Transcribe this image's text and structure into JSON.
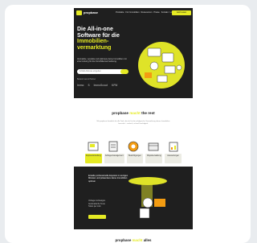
{
  "brand": {
    "logo_mark": "sk",
    "name": "propbase"
  },
  "nav": {
    "links": [
      "Produkte",
      "Für Immobilien",
      "Ressourcen",
      "Preise",
      "Kontakt",
      "Login"
    ],
    "cta": "Jetzt testen"
  },
  "hero": {
    "title_lines": [
      "Die All-in-one",
      "Software für die"
    ],
    "title_highlight_lines": [
      "Immobilien-",
      "vermarktung"
    ],
    "subtitle": "Vermarkte, verwalte und optimiere deine Immobilien mit einer Lösung für die Immobilienvermarktung.",
    "input_placeholder": "E-Mail-Adresse eingeben",
    "references_label": "Bekannt aus & Partner",
    "reference_logos": [
      "Immo",
      "S",
      "ImmoScout",
      "KFW"
    ]
  },
  "features_intro": {
    "logo_prefix": "propbase",
    "logo_highlight": "macht",
    "logo_suffix": "the rest",
    "text": "Mit propbase bündelst du alle Tools, die du für die erfolgreiche Vermarktung deiner Immobilien brauchst – einfach, schnell und digital."
  },
  "tabs": [
    {
      "label": "Exposé-Erstellung",
      "active": true
    },
    {
      "label": "Anfragenmanagement",
      "active": false
    },
    {
      "label": "Besichtigungen",
      "active": false
    },
    {
      "label": "Objektverwaltung",
      "active": false
    },
    {
      "label": "Auswertungen",
      "active": false
    }
  ],
  "feature": {
    "title": "Erstelle professionelle Exposés in wenigen Minuten und präsentiere deine Immobilien optimal.",
    "list": [
      "Vorlagen & Designs",
      "Automatische Texte",
      "Teilen per Link"
    ]
  },
  "footer": {
    "logo_prefix": "propbase",
    "logo_highlight": "macht",
    "logo_suffix": "alles"
  },
  "colors": {
    "accent": "#e5ea24",
    "dark": "#1f1f1f"
  }
}
